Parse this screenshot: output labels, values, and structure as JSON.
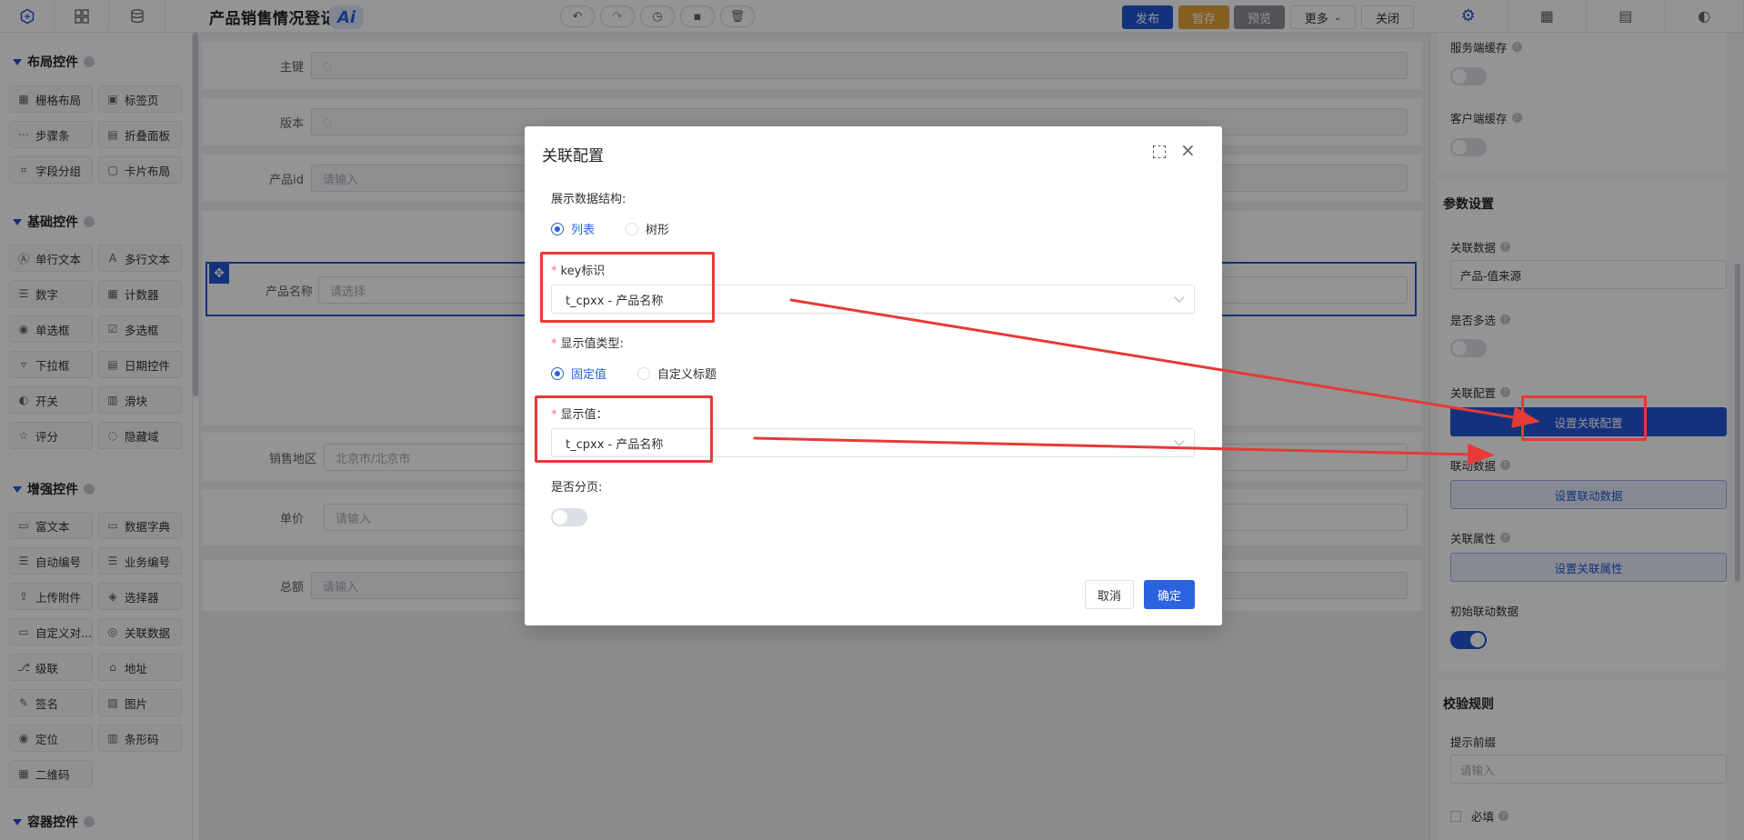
{
  "topbar": {
    "title": "产品销售情况登记",
    "ai_label": "Ai",
    "publish": "发布",
    "save_draft": "暂存",
    "preview": "预览",
    "more": "更多",
    "close": "关闭"
  },
  "left_panel": {
    "sections": {
      "layout": "布局控件",
      "basic": "基础控件",
      "enhanced": "增强控件",
      "container": "容器控件"
    },
    "layout_items": [
      "栅格布局",
      "标签页",
      "步骤条",
      "折叠面板",
      "字段分组",
      "卡片布局"
    ],
    "basic_items": [
      "单行文本",
      "多行文本",
      "数字",
      "计数器",
      "单选框",
      "多选框",
      "下拉框",
      "日期控件",
      "开关",
      "滑块",
      "评分",
      "隐藏域"
    ],
    "enhanced_items": [
      "富文本",
      "数据字典",
      "自动编号",
      "业务编号",
      "上传附件",
      "选择器",
      "自定义对...",
      "关联数据",
      "级联",
      "地址",
      "签名",
      "图片",
      "定位",
      "条形码",
      "二维码"
    ]
  },
  "canvas": {
    "rows": [
      {
        "label": "主键",
        "placeholder": ""
      },
      {
        "label": "版本",
        "placeholder": ""
      },
      {
        "label": "产品id",
        "placeholder": "请输入"
      },
      {
        "label": "产品名称",
        "placeholder": "请选择"
      },
      {
        "label": "销售地区",
        "placeholder": "北京市/北京市"
      },
      {
        "label": "单价",
        "placeholder": "请输入"
      },
      {
        "label": "总额",
        "placeholder": "请输入"
      }
    ]
  },
  "right_panel": {
    "server_cache": "服务端缓存",
    "client_cache": "客户端缓存",
    "param_settings": "参数设置",
    "related_data_label": "关联数据",
    "related_data_value": "产品-值来源",
    "multi_select": "是否多选",
    "related_config": "关联配置",
    "set_related_config": "设置关联配置",
    "linked_data": "联动数据",
    "set_linked_data": "设置联动数据",
    "related_attr": "关联属性",
    "set_related_attr": "设置关联属性",
    "init_linked_data": "初始联动数据",
    "validation_rules": "校验规则",
    "hint_prefix": "提示前缀",
    "hint_placeholder": "请输入",
    "required": "必填"
  },
  "modal": {
    "title": "关联配置",
    "display_structure_label": "展示数据结构:",
    "structure_options": [
      "列表",
      "树形"
    ],
    "key_label": "key标识",
    "key_value": "t_cpxx - 产品名称",
    "display_type_label": "显示值类型:",
    "display_type_options": [
      "固定值",
      "自定义标题"
    ],
    "display_value_label": "显示值：",
    "display_value": "t_cpxx - 产品名称",
    "paging_label": "是否分页:",
    "cancel": "取消",
    "confirm": "确定"
  },
  "colors": {
    "primary": "#2457d6",
    "accent_orange": "#e6a23c",
    "annotation_red": "#e63a36"
  }
}
